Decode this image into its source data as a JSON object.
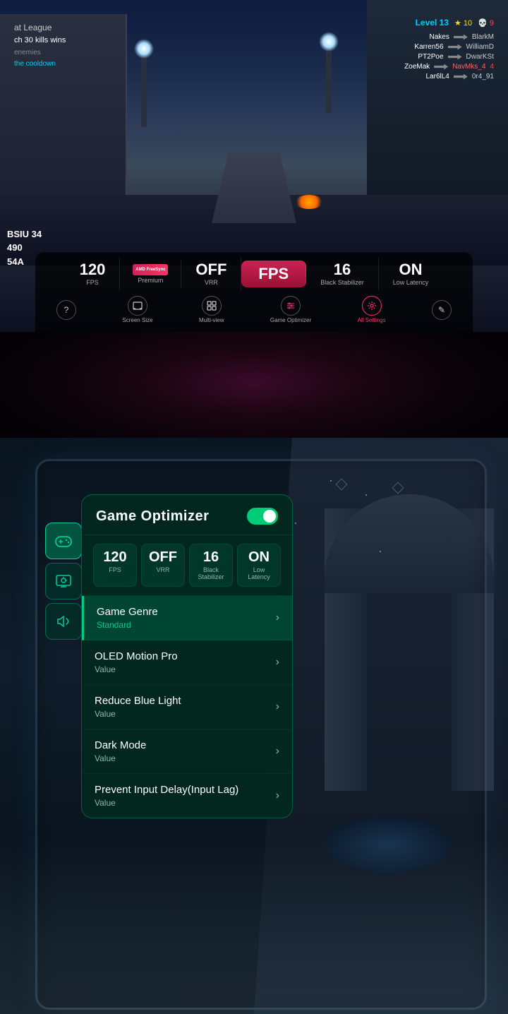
{
  "top_section": {
    "hud": {
      "match_name": "at League",
      "kill_info": "ch 30 kills wins",
      "enemies_label": "enemies",
      "cooldown_text": "the cooldown",
      "level": "Level 13",
      "star_count": "★ 10",
      "skull_count": "💀 9",
      "scoreboard": [
        {
          "name": "Nakes",
          "alias": "BlarkM",
          "score": ""
        },
        {
          "name": "KarrenS6",
          "alias": "WilliamD",
          "score": ""
        },
        {
          "name": "PT2Poe",
          "alias": "DwarKSt",
          "score": ""
        },
        {
          "name": "ZoeMak",
          "alias": "NavMks_4",
          "score": "4"
        },
        {
          "name": "Lar6lL4",
          "alias": "0r4_91",
          "score": ""
        }
      ]
    },
    "stats": {
      "fps_value": "120",
      "fps_label": "FPS",
      "freesync_label": "FreeSync",
      "freesync_sub": "Premium",
      "vrr_value": "OFF",
      "vrr_label": "VRR",
      "mode_value": "FPS",
      "bs_value": "16",
      "bs_label": "Black Stabilizer",
      "latency_value": "ON",
      "latency_label": "Low Latency"
    },
    "score_overlay": {
      "line1": "BSIU  34",
      "line2": "      490",
      "line3": "      54A"
    },
    "controls": {
      "help": "?",
      "screen_size_label": "Screen Size",
      "multi_view_label": "Multi-view",
      "game_optimizer_label": "Game Optimizer",
      "all_settings_label": "All Settings",
      "edit_icon": "✎"
    }
  },
  "optimizer_panel": {
    "title": "Game Optimizer",
    "toggle_on": true,
    "quick_stats": [
      {
        "value": "120",
        "label": "FPS"
      },
      {
        "value": "OFF",
        "label": "VRR"
      },
      {
        "value": "16",
        "label": "Black Stabilizer"
      },
      {
        "value": "ON",
        "label": "Low Latency"
      }
    ],
    "menu_items": [
      {
        "title": "Game Genre",
        "value": "Standard",
        "highlighted": true
      },
      {
        "title": "OLED Motion Pro",
        "value": "Value",
        "highlighted": false
      },
      {
        "title": "Reduce Blue Light",
        "value": "Value",
        "highlighted": false
      },
      {
        "title": "Dark Mode",
        "value": "Value",
        "highlighted": false
      },
      {
        "title": "Prevent Input Delay(Input Lag)",
        "value": "Value",
        "highlighted": false
      }
    ]
  },
  "side_panel": {
    "icons": [
      {
        "symbol": "🎮",
        "label": "gamepad"
      },
      {
        "symbol": "✦",
        "label": "star"
      },
      {
        "symbol": "🔊",
        "label": "audio"
      }
    ]
  }
}
